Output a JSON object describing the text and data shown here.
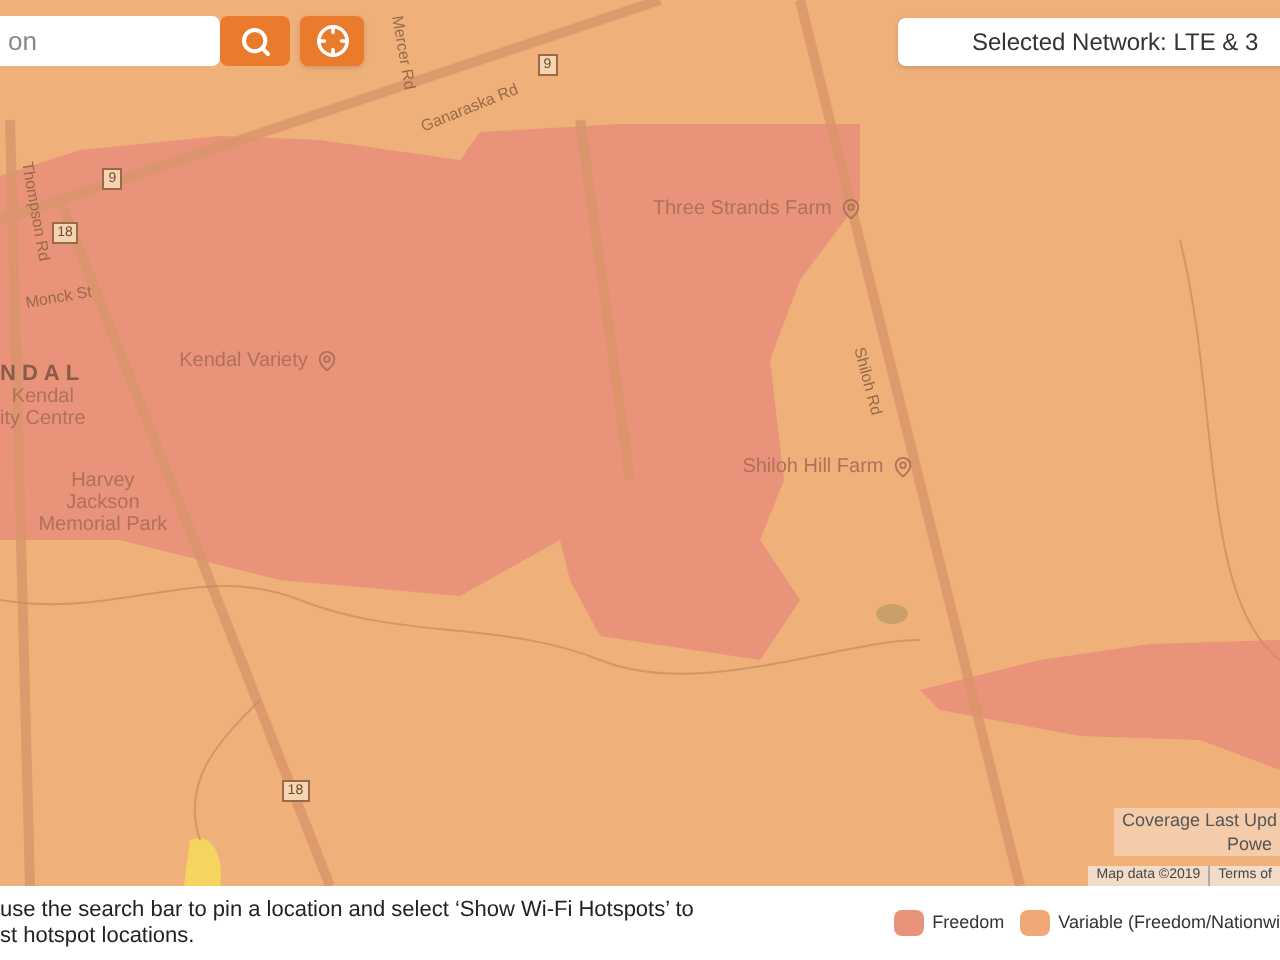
{
  "search": {
    "placeholder": "on"
  },
  "network": {
    "label": "Selected Network: LTE & 3"
  },
  "map_labels": [
    {
      "kind": "road",
      "text": "Ganaraska Rd"
    },
    {
      "kind": "road",
      "text": "Thompson Rd"
    },
    {
      "kind": "road",
      "text": "Mercer Rd"
    },
    {
      "kind": "road",
      "text": "Monck St"
    },
    {
      "kind": "road",
      "text": "Shiloh Rd"
    },
    {
      "kind": "shield",
      "text": "9"
    },
    {
      "kind": "shield",
      "text": "9"
    },
    {
      "kind": "shield",
      "text": "18"
    },
    {
      "kind": "shield",
      "text": "18"
    },
    {
      "kind": "place",
      "text": "Three Strands Farm"
    },
    {
      "kind": "place",
      "text": "Kendal Variety"
    },
    {
      "kind": "place",
      "text": "Shiloh Hill Farm"
    },
    {
      "kind": "town",
      "text": "NDAL"
    },
    {
      "kind": "area",
      "text": "Kendal\nity Centre"
    },
    {
      "kind": "area",
      "text": "Harvey\nJackson\nMemorial Park"
    }
  ],
  "attribution": {
    "lines": [
      "Coverage Last Upd",
      "Powe"
    ],
    "map_data": "Map data ©2019",
    "terms": "Terms of"
  },
  "footer": {
    "hint": "use the search bar to pin a location and select ‘Show Wi-Fi Hotspots’ to\nst hotspot locations.",
    "legend": [
      {
        "label": "Freedom",
        "color": "#e8937a"
      },
      {
        "label": "Variable (Freedom/Nationwi",
        "color": "#efa876"
      }
    ]
  }
}
